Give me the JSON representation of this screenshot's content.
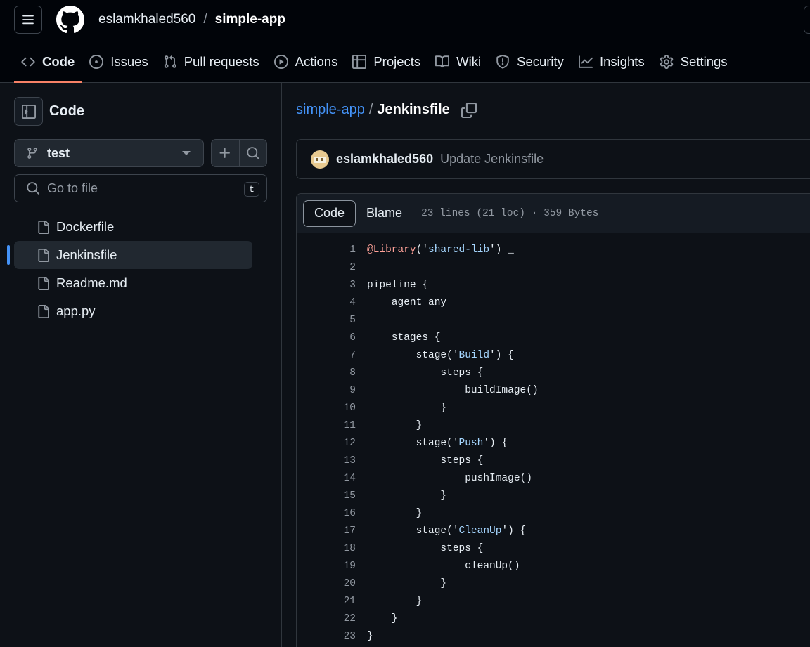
{
  "header": {
    "owner": "eslamkhaled560",
    "separator": "/",
    "repo": "simple-app"
  },
  "nav": [
    {
      "label": "Code",
      "icon": "code-icon",
      "selected": true
    },
    {
      "label": "Issues",
      "icon": "issue-opened-icon"
    },
    {
      "label": "Pull requests",
      "icon": "git-pull-request-icon"
    },
    {
      "label": "Actions",
      "icon": "play-icon"
    },
    {
      "label": "Projects",
      "icon": "table-icon"
    },
    {
      "label": "Wiki",
      "icon": "book-icon"
    },
    {
      "label": "Security",
      "icon": "shield-icon"
    },
    {
      "label": "Insights",
      "icon": "graph-icon"
    },
    {
      "label": "Settings",
      "icon": "gear-icon"
    }
  ],
  "sidebar": {
    "title": "Code",
    "branch": "test",
    "go_to_file_placeholder": "Go to file",
    "shortcut": "t",
    "files": [
      {
        "name": "Dockerfile",
        "active": false
      },
      {
        "name": "Jenkinsfile",
        "active": true
      },
      {
        "name": "Readme.md",
        "active": false
      },
      {
        "name": "app.py",
        "active": false
      }
    ]
  },
  "breadcrumb": {
    "repo": "simple-app",
    "sep": "/",
    "file": "Jenkinsfile"
  },
  "commit": {
    "author": "eslamkhaled560",
    "message": "Update Jenkinsfile"
  },
  "file_header": {
    "tab_code": "Code",
    "tab_blame": "Blame",
    "meta": "23 lines (21 loc) · 359 Bytes"
  },
  "code_lines": [
    "@Library('shared-lib') _",
    "",
    "pipeline {",
    "    agent any",
    "",
    "    stages {",
    "        stage('Build') {",
    "            steps {",
    "                buildImage()",
    "            }",
    "        }",
    "        stage('Push') {",
    "            steps {",
    "                pushImage()",
    "            }",
    "        }",
    "        stage('CleanUp') {",
    "            steps {",
    "                cleanUp()",
    "            }",
    "        }",
    "    }",
    "}"
  ],
  "colors": {
    "accent_underline": "#f78166",
    "link": "#4493f8",
    "active_bar": "#4493f8",
    "string": "#a5d6ff",
    "decorator": "#ffa198"
  }
}
